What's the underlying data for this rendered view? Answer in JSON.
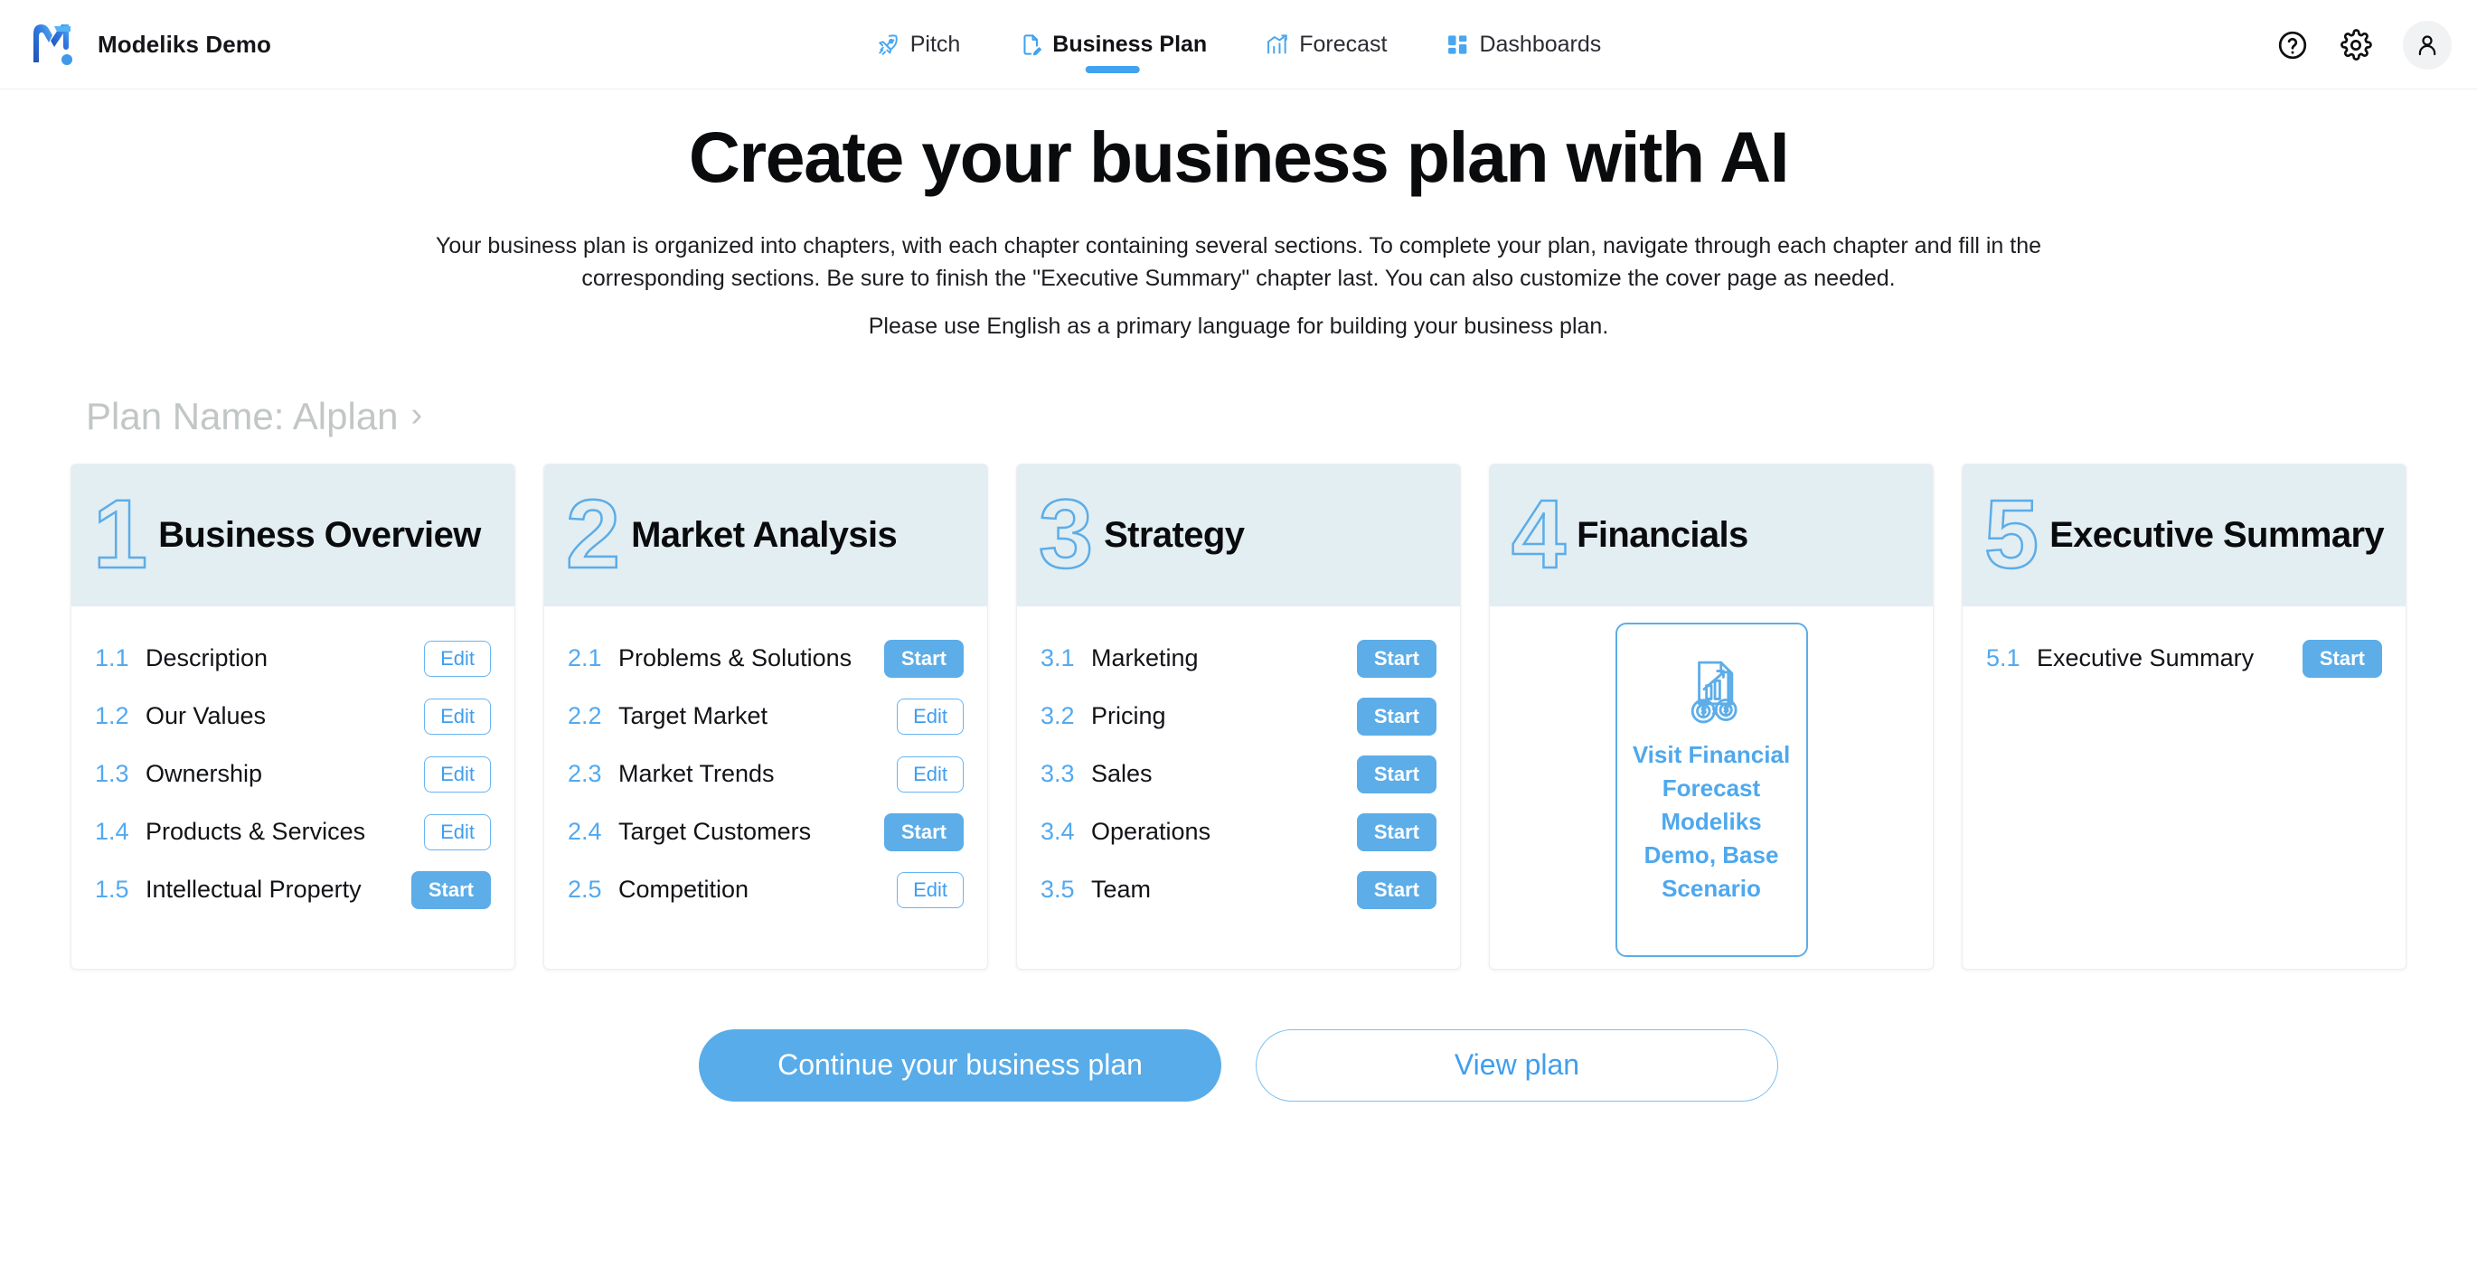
{
  "header": {
    "brand_name": "Modeliks Demo",
    "logo_icon": "modeliks-m-logo",
    "tabs": [
      {
        "label": "Pitch",
        "icon": "rocket-icon",
        "active": false
      },
      {
        "label": "Business Plan",
        "icon": "document-edit-icon",
        "active": true
      },
      {
        "label": "Forecast",
        "icon": "chart-trend-icon",
        "active": false
      },
      {
        "label": "Dashboards",
        "icon": "grid-layout-icon",
        "active": false
      }
    ],
    "help_icon": "help-circle-icon",
    "settings_icon": "gear-icon",
    "avatar_icon": "user-avatar-icon"
  },
  "hero": {
    "title": "Create your business plan with AI",
    "paragraph_1": "Your business plan is organized into chapters, with each chapter containing several sections. To complete your plan, navigate through each chapter and fill in the corresponding sections. Be sure to finish the \"Executive Summary\" chapter last. You can also customize the cover page as needed.",
    "paragraph_2": "Please use English as a primary language for building your business plan."
  },
  "plan": {
    "name_label": "Plan Name: Alplan",
    "chevron": "›"
  },
  "chapters": [
    {
      "number": "1",
      "title": "Business Overview",
      "sections": [
        {
          "num": "1.1",
          "label": "Description",
          "action": "Edit"
        },
        {
          "num": "1.2",
          "label": "Our Values",
          "action": "Edit"
        },
        {
          "num": "1.3",
          "label": "Ownership",
          "action": "Edit"
        },
        {
          "num": "1.4",
          "label": "Products & Services",
          "action": "Edit"
        },
        {
          "num": "1.5",
          "label": "Intellectual Property",
          "action": "Start"
        }
      ]
    },
    {
      "number": "2",
      "title": "Market Analysis",
      "sections": [
        {
          "num": "2.1",
          "label": "Problems & Solutions",
          "action": "Start"
        },
        {
          "num": "2.2",
          "label": "Target Market",
          "action": "Edit"
        },
        {
          "num": "2.3",
          "label": "Market Trends",
          "action": "Edit"
        },
        {
          "num": "2.4",
          "label": "Target Customers",
          "action": "Start"
        },
        {
          "num": "2.5",
          "label": "Competition",
          "action": "Edit"
        }
      ]
    },
    {
      "number": "3",
      "title": "Strategy",
      "sections": [
        {
          "num": "3.1",
          "label": "Marketing",
          "action": "Start"
        },
        {
          "num": "3.2",
          "label": "Pricing",
          "action": "Start"
        },
        {
          "num": "3.3",
          "label": "Sales",
          "action": "Start"
        },
        {
          "num": "3.4",
          "label": "Operations",
          "action": "Start"
        },
        {
          "num": "3.5",
          "label": "Team",
          "action": "Start"
        }
      ]
    },
    {
      "number": "4",
      "title": "Financials",
      "sections": [],
      "financial_panel": {
        "icon": "financial-forecast-icon",
        "text": "Visit Financial Forecast Modeliks Demo, Base Scenario"
      }
    },
    {
      "number": "5",
      "title": "Executive Summary",
      "sections": [
        {
          "num": "5.1",
          "label": "Executive Summary",
          "action": "Start"
        }
      ]
    }
  ],
  "footer": {
    "primary_label": "Continue your business plan",
    "secondary_label": "View plan"
  },
  "colors": {
    "accent_blue": "#5cade8",
    "link_blue": "#3f9eef",
    "card_header_bg": "#e3eef3",
    "muted_gray": "#c2c6c6"
  }
}
